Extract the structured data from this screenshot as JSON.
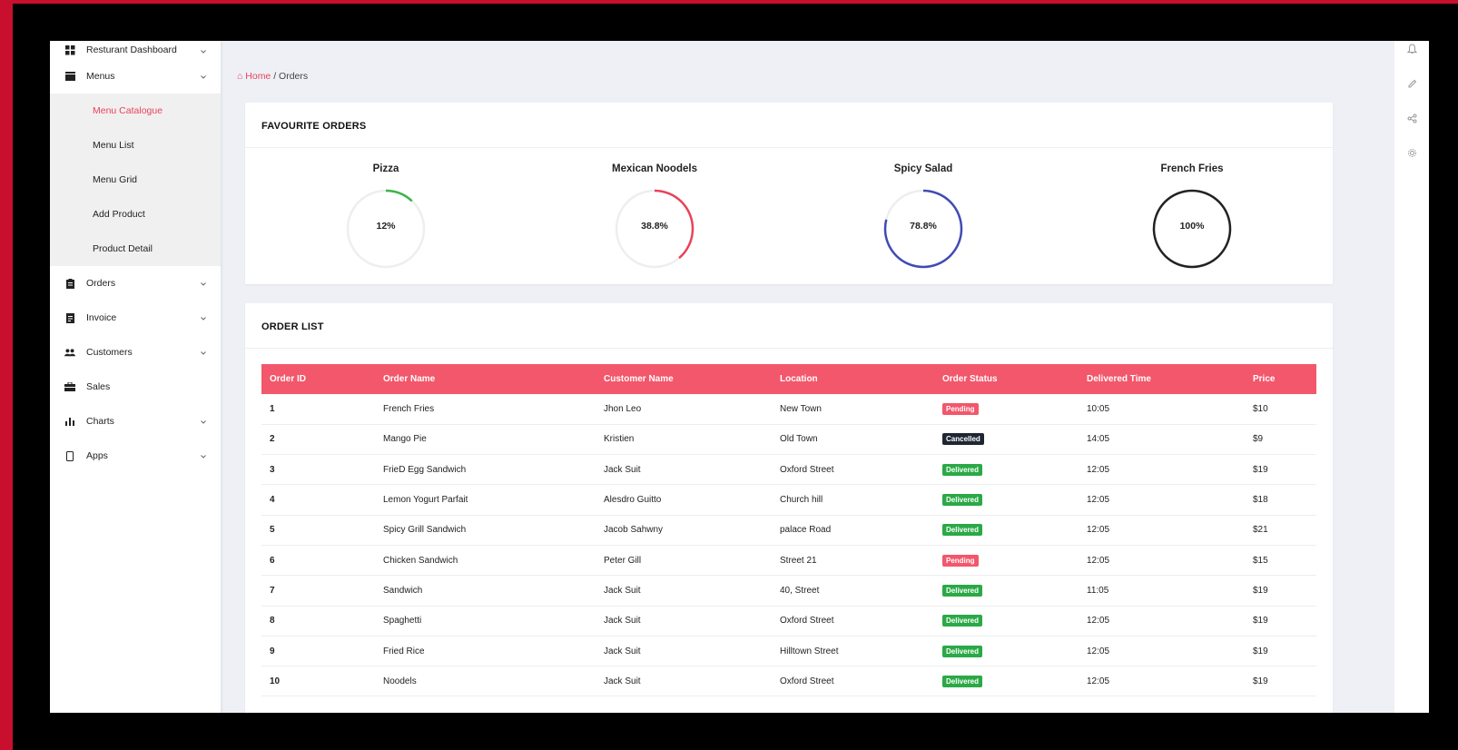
{
  "sidebar": {
    "items": [
      {
        "label": "Resturant Dashboard",
        "icon": "dashboard-icon",
        "chevron": true
      },
      {
        "label": "Menus",
        "icon": "menu-book-icon",
        "chevron": true
      },
      {
        "label": "Orders",
        "icon": "clipboard-icon",
        "chevron": true
      },
      {
        "label": "Invoice",
        "icon": "document-icon",
        "chevron": true
      },
      {
        "label": "Customers",
        "icon": "users-icon",
        "chevron": true
      },
      {
        "label": "Sales",
        "icon": "briefcase-icon",
        "chevron": false
      },
      {
        "label": "Charts",
        "icon": "bar-chart-icon",
        "chevron": true
      },
      {
        "label": "Apps",
        "icon": "mobile-icon",
        "chevron": true
      }
    ],
    "submenu": [
      {
        "label": "Menu Catalogue",
        "active": true
      },
      {
        "label": "Menu List",
        "active": false
      },
      {
        "label": "Menu Grid",
        "active": false
      },
      {
        "label": "Add Product",
        "active": false
      },
      {
        "label": "Product Detail",
        "active": false
      }
    ]
  },
  "breadcrumb": {
    "home": "Home",
    "separator": "/",
    "current": "Orders"
  },
  "favourites": {
    "title": "FAVOURITE ORDERS",
    "items": [
      {
        "name": "Pizza",
        "percent_label": "12%",
        "value": 12,
        "color": "#3cb44b"
      },
      {
        "name": "Mexican Noodels",
        "percent_label": "38.8%",
        "value": 38.8,
        "color": "#e8435a"
      },
      {
        "name": "Spicy Salad",
        "percent_label": "78.8%",
        "value": 78.8,
        "color": "#3f4bb5"
      },
      {
        "name": "French Fries",
        "percent_label": "100%",
        "value": 100,
        "color": "#222222"
      }
    ]
  },
  "order_list": {
    "title": "ORDER LIST",
    "columns": [
      "Order ID",
      "Order Name",
      "Customer Name",
      "Location",
      "Order Status",
      "Delivered Time",
      "Price"
    ],
    "rows": [
      [
        "1",
        "French Fries",
        "Jhon Leo",
        "New Town",
        "Pending",
        "10:05",
        "$10"
      ],
      [
        "2",
        "Mango Pie",
        "Kristien",
        "Old Town",
        "Cancelled",
        "14:05",
        "$9"
      ],
      [
        "3",
        "FrieD Egg Sandwich",
        "Jack Suit",
        "Oxford Street",
        "Delivered",
        "12:05",
        "$19"
      ],
      [
        "4",
        "Lemon Yogurt Parfait",
        "Alesdro Guitto",
        "Church hill",
        "Delivered",
        "12:05",
        "$18"
      ],
      [
        "5",
        "Spicy Grill Sandwich",
        "Jacob Sahwny",
        "palace Road",
        "Delivered",
        "12:05",
        "$21"
      ],
      [
        "6",
        "Chicken Sandwich",
        "Peter Gill",
        "Street 21",
        "Pending",
        "12:05",
        "$15"
      ],
      [
        "7",
        "Sandwich",
        "Jack Suit",
        "40, Street",
        "Delivered",
        "11:05",
        "$19"
      ],
      [
        "8",
        "Spaghetti",
        "Jack Suit",
        "Oxford Street",
        "Delivered",
        "12:05",
        "$19"
      ],
      [
        "9",
        "Fried Rice",
        "Jack Suit",
        "Hilltown Street",
        "Delivered",
        "12:05",
        "$19"
      ],
      [
        "10",
        "Noodels",
        "Jack Suit",
        "Oxford Street",
        "Delivered",
        "12:05",
        "$19"
      ]
    ]
  },
  "rail_icons": [
    "bell-icon",
    "pencil-icon",
    "share-icon",
    "gear-icon"
  ],
  "colors": {
    "accent": "#e8435a",
    "header": "#f2576b",
    "delivered": "#2aa946",
    "cancelled": "#1f2633"
  }
}
